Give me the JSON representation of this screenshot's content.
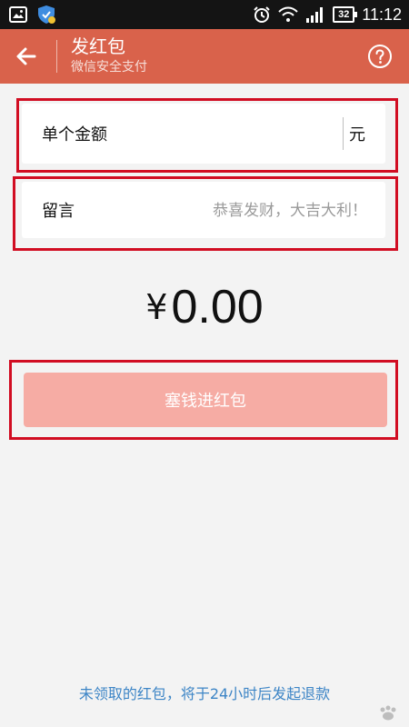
{
  "status_bar": {
    "battery_level": "32",
    "time": "11:12"
  },
  "header": {
    "title": "发红包",
    "subtitle": "微信安全支付",
    "back_icon": "arrow-left-icon",
    "help_icon": "question-circle-icon"
  },
  "amount_field": {
    "label": "单个金额",
    "value": "",
    "placeholder": "",
    "unit": "元"
  },
  "message_field": {
    "label": "留言",
    "value": "",
    "placeholder": "恭喜发财，大吉大利！"
  },
  "amount_display": {
    "currency_symbol": "¥",
    "value": "0.00"
  },
  "submit_button": {
    "label": "塞钱进红包"
  },
  "footer": {
    "note": "未领取的红包，将于24小时后发起退款"
  },
  "colors": {
    "header_bg": "#d9624b",
    "submit_bg": "#f6aca4",
    "annotation_border": "#d10d22",
    "footer_text": "#3d85c6",
    "page_bg": "#f3f3f3"
  }
}
